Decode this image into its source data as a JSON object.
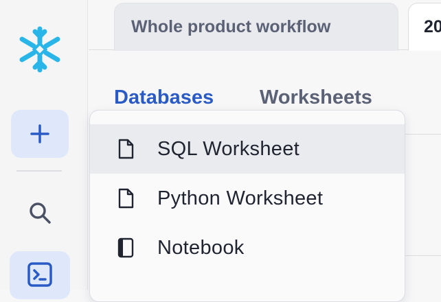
{
  "rail": {
    "logo_icon": "snowflake-icon",
    "add_icon": "plus-icon",
    "search_icon": "search-icon",
    "worksheets_icon": "terminal-icon",
    "accent": "#29b5e8"
  },
  "tabs": [
    {
      "label": "Whole product workflow"
    },
    {
      "label": "20"
    }
  ],
  "nav": {
    "databases": "Databases",
    "worksheets": "Worksheets"
  },
  "menu": {
    "items": [
      {
        "label": "SQL Worksheet",
        "icon": "file-icon",
        "active": true
      },
      {
        "label": "Python Worksheet",
        "icon": "file-icon",
        "active": false
      },
      {
        "label": "Notebook",
        "icon": "notebook-icon",
        "active": false
      }
    ]
  }
}
